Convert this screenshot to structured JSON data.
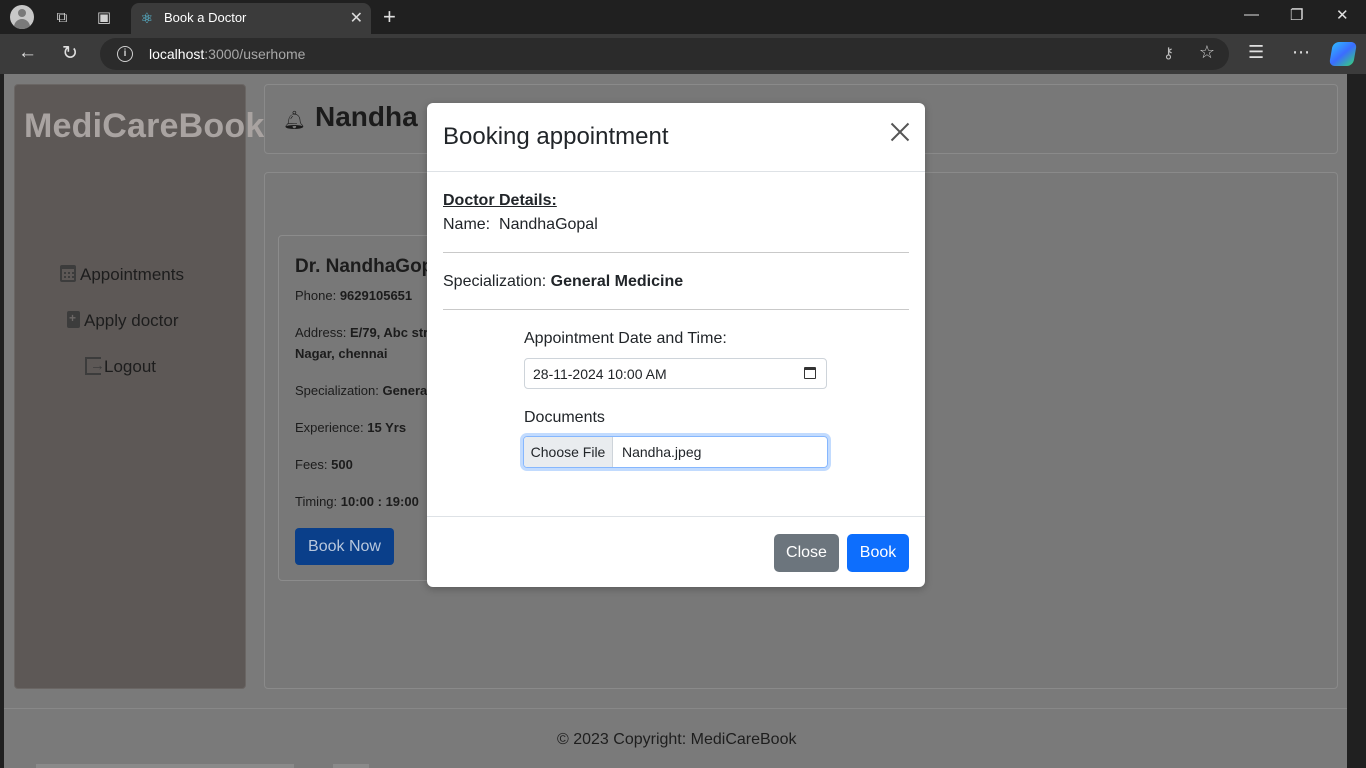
{
  "browser": {
    "tab_title": "Book a Doctor",
    "url_host": "localhost",
    "url_path": ":3000/userhome"
  },
  "sidebar": {
    "brand": "MediCareBook",
    "items": [
      {
        "label": "Appointments",
        "icon": "calendar-icon"
      },
      {
        "label": "Apply doctor",
        "icon": "medical-file-icon"
      },
      {
        "label": "Logout",
        "icon": "logout-icon"
      }
    ]
  },
  "header": {
    "user_name": "Nandha"
  },
  "doctor_card": {
    "name": "Dr. NandhaGopal",
    "phone_label": "Phone:",
    "phone": "9629105651",
    "address_label": "Address:",
    "address_line1": "E/79, Abc street,",
    "address_line2": "Nagar, chennai",
    "specialization_label": "Specialization:",
    "specialization": "General Medicine",
    "experience_label": "Experience:",
    "experience": "15 Yrs",
    "fees_label": "Fees:",
    "fees": "500",
    "timing_label": "Timing:",
    "timing": "10:00 : 19:00",
    "book_button": "Book Now"
  },
  "modal": {
    "title": "Booking appointment",
    "details_heading": "Doctor Details:",
    "name_label": "Name:",
    "name_value": "NandhaGopal",
    "specialization_label": "Specialization:",
    "specialization_value": "General Medicine",
    "date_label": "Appointment Date and Time:",
    "date_value": "28-11-2024 10:00  AM",
    "documents_label": "Documents",
    "choose_file": "Choose File",
    "file_name": "Nandha.jpeg",
    "close_button": "Close",
    "book_button": "Book"
  },
  "footer": {
    "text": "© 2023 Copyright: MediCareBook"
  },
  "colors": {
    "primary": "#0d6efd",
    "secondary": "#6c757d",
    "overlay": "#7a7a7a"
  }
}
